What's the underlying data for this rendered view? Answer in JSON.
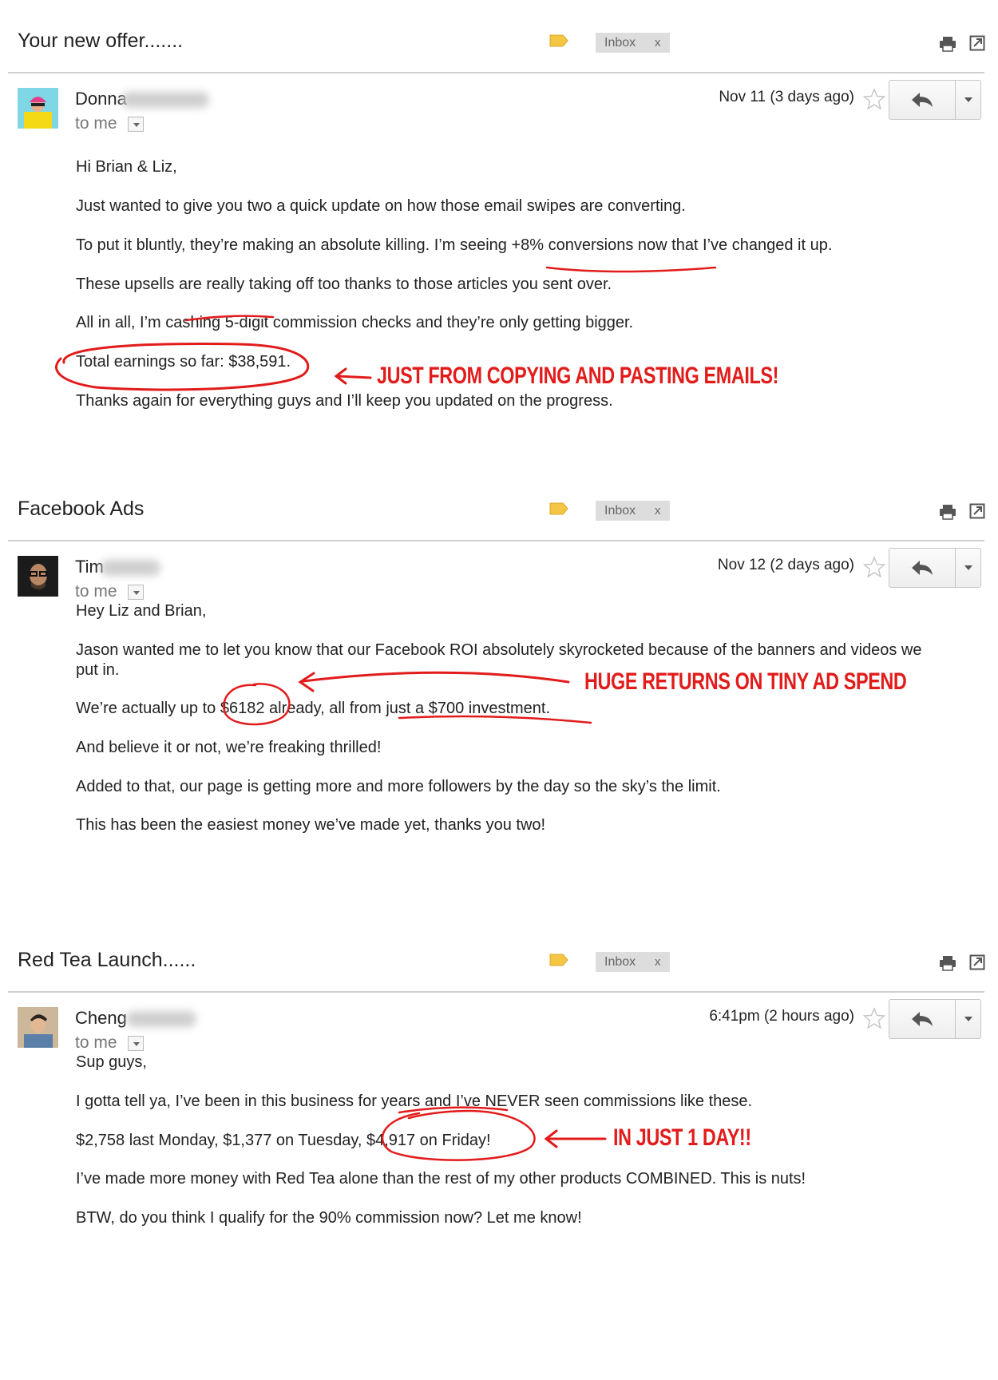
{
  "accent_colors": {
    "annotation": "#e21b1b",
    "label_tag": "#f5c544",
    "inbox_chip": "#dddddd"
  },
  "emails": [
    {
      "subject": "Your new offer.......",
      "inbox_label": "Inbox",
      "remove_label": "x",
      "sender": "Donna",
      "recipient": "to me",
      "date": "Nov 11 (3 days ago)",
      "avatar_icon": "avatar-woman-yellow-hoodie",
      "paragraphs": [
        "Hi Brian & Liz,",
        "Just wanted to give you two a quick update on how those email swipes are converting.",
        "To put it bluntly, they’re making an absolute killing. I’m seeing +8% conversions now that I’ve changed it up.",
        "These upsells are really taking off too thanks to those articles you sent over.",
        "All in all, I’m cashing 5-digit commission checks and they’re only getting bigger.",
        "Total earnings so far: $38,591.",
        "Thanks again for everything guys and I’ll keep you updated on the progress."
      ],
      "callout": "JUST FROM COPYING AND PASTING EMAILS!"
    },
    {
      "subject": "Facebook Ads",
      "inbox_label": "Inbox",
      "remove_label": "x",
      "sender": "Tim",
      "recipient": "to me",
      "date": "Nov 12 (2 days ago)",
      "avatar_icon": "avatar-man-glasses",
      "paragraphs": [
        "Hey Liz and Brian,",
        "Jason wanted me to let you know that our Facebook ROI absolutely skyrocketed because of the banners and videos we put in.",
        "We’re actually up to $6182 already, all from just a $700 investment.",
        "And believe it or not, we’re freaking thrilled!",
        "Added to that, our page is getting more and more followers by the day so the sky’s the limit.",
        "This has been the easiest money we’ve made yet, thanks you two!"
      ],
      "callout": "HUGE RETURNS ON TINY AD SPEND"
    },
    {
      "subject": "Red Tea Launch......",
      "inbox_label": "Inbox",
      "remove_label": "x",
      "sender": "Cheng",
      "recipient": "to me",
      "date": "6:41pm (2 hours ago)",
      "avatar_icon": "avatar-man-denim-shirt",
      "paragraphs": [
        "Sup guys,",
        "I gotta tell ya, I’ve been in this business for years and I’ve NEVER seen commissions like these.",
        "$2,758 last Monday, $1,377 on Tuesday, $4,917 on Friday!",
        "I’ve made more money with Red Tea alone than the rest of my other products COMBINED. This is nuts!",
        "BTW, do you think I qualify for the 90% commission now? Let me know!"
      ],
      "callout": "IN JUST 1 DAY!!"
    }
  ]
}
